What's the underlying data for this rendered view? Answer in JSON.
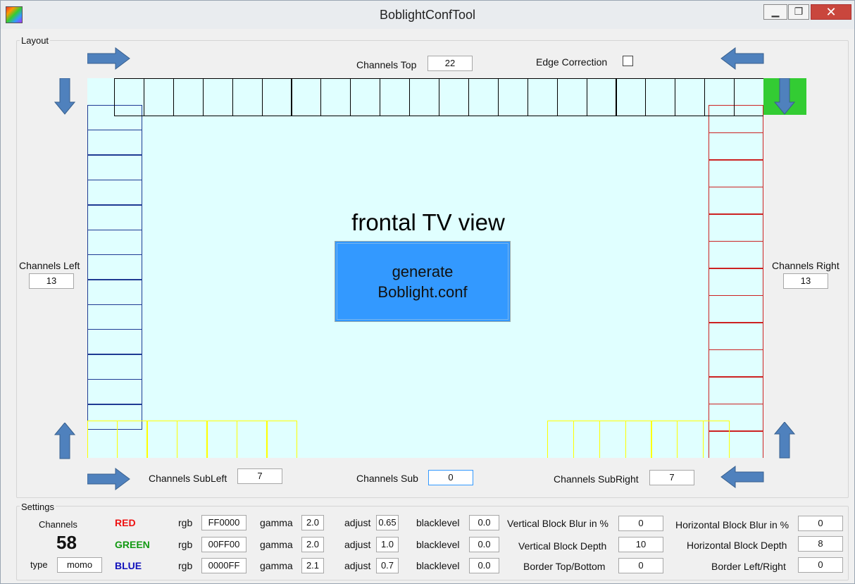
{
  "window": {
    "title": "BoblightConfTool",
    "min_label": "▁",
    "max_label": "❐",
    "close_label": "✕"
  },
  "layout": {
    "group_title": "Layout",
    "channels_top_label": "Channels Top",
    "channels_top_value": "22",
    "edge_correction_label": "Edge Correction",
    "edge_correction_checked": false,
    "channels_left_label": "Channels Left",
    "channels_left_value": "13",
    "channels_right_label": "Channels Right",
    "channels_right_value": "13",
    "channels_subleft_label": "Channels SubLeft",
    "channels_subleft_value": "7",
    "channels_sub_label": "Channels Sub",
    "channels_sub_value": "0",
    "channels_subright_label": "Channels SubRight",
    "channels_subright_value": "7",
    "tv_title": "frontal TV view",
    "generate_line1": "generate",
    "generate_line2": "Boblight.conf",
    "colors": {
      "tv_bg": "#e0ffff",
      "left": "#1f3a93",
      "right": "#cc2222",
      "top": "#000000",
      "sub": "#ffff00",
      "start_marker": "#33cc33",
      "arrow": "#4f81bd",
      "button": "#3399ff"
    }
  },
  "settings": {
    "group_title": "Settings",
    "channels_label": "Channels",
    "channels_count": "58",
    "type_label": "type",
    "type_value": "momo",
    "colors": [
      {
        "name": "RED",
        "color": "#ee1111",
        "rgb_label": "rgb",
        "rgb": "FF0000",
        "gamma_label": "gamma",
        "gamma": "2.0",
        "adjust_label": "adjust",
        "adjust": "0.65",
        "blacklevel_label": "blacklevel",
        "blacklevel": "0.0"
      },
      {
        "name": "GREEN",
        "color": "#119911",
        "rgb_label": "rgb",
        "rgb": "00FF00",
        "gamma_label": "gamma",
        "gamma": "2.0",
        "adjust_label": "adjust",
        "adjust": "1.0",
        "blacklevel_label": "blacklevel",
        "blacklevel": "0.0"
      },
      {
        "name": "BLUE",
        "color": "#1111bb",
        "rgb_label": "rgb",
        "rgb": "0000FF",
        "gamma_label": "gamma",
        "gamma": "2.1",
        "adjust_label": "adjust",
        "adjust": "0.7",
        "blacklevel_label": "blacklevel",
        "blacklevel": "0.0"
      }
    ],
    "vblur_label": "Vertical Block Blur in %",
    "vblur": "0",
    "vdepth_label": "Vertical Block Depth",
    "vdepth": "10",
    "border_tb_label": "Border Top/Bottom",
    "border_tb": "0",
    "hblur_label": "Horizontal Block Blur in %",
    "hblur": "0",
    "hdepth_label": "Horizontal Block Depth",
    "hdepth": "8",
    "border_lr_label": "Border Left/Right",
    "border_lr": "0"
  }
}
